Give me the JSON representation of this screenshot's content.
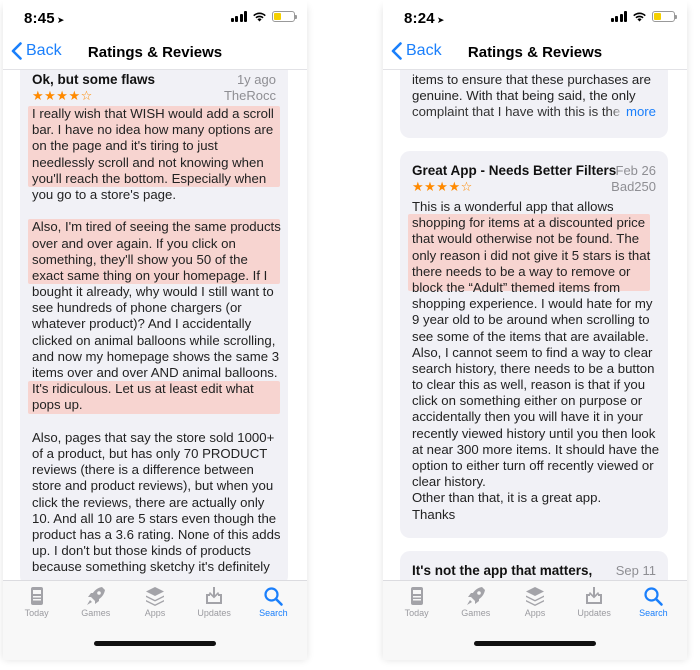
{
  "screens": [
    {
      "status": {
        "time": "8:45",
        "battery_color": "#f5d000"
      },
      "nav": {
        "back_label": "Back",
        "title": "Ratings & Reviews"
      },
      "review": {
        "title": "Ok, but some flaws",
        "date": "1y ago",
        "stars": "★★★★☆",
        "author": "TheRocc",
        "paragraphs": [
          [
            "I really wish that WISH would add a scroll",
            "bar. I have no idea how many options are",
            "on the page and it's tiring to just",
            "needlessly scroll and not knowing when",
            "you'll reach the bottom. Especially when",
            "you go to a store's page."
          ],
          [
            "Also, I'm tired of seeing the same products",
            "over and over again. If you click on",
            "something, they'll show you 50 of the",
            "exact same thing on your homepage. If I",
            "bought it already, why would I still want to",
            "see hundreds of phone chargers (or",
            "whatever product)? And I accidentally",
            "clicked on animal balloons while scrolling,",
            "and now my homepage shows the same 3",
            "items over and over AND animal balloons.",
            "It's ridiculous. Let us at least edit what",
            "pops up."
          ],
          [
            "Also, pages that say the store sold 1000+",
            "of a product, but has only 70 PRODUCT",
            "reviews (there is a difference between",
            "store and product reviews), but when you",
            "click the reviews, there are actually only",
            "10. And all 10 are 5 stars even though the",
            "product has a 3.6 rating. None of this adds",
            "up. I don't but those kinds of products",
            "because something sketchy it's definitely"
          ]
        ]
      },
      "tabs": [
        {
          "label": "Today",
          "icon": "today-icon"
        },
        {
          "label": "Games",
          "icon": "rocket-icon"
        },
        {
          "label": "Apps",
          "icon": "stack-icon"
        },
        {
          "label": "Updates",
          "icon": "download-icon"
        },
        {
          "label": "Search",
          "icon": "search-icon"
        }
      ]
    },
    {
      "status": {
        "time": "8:24",
        "battery_color": "#f5d000"
      },
      "nav": {
        "back_label": "Back",
        "title": "Ratings & Reviews"
      },
      "prev_review": {
        "lines": [
          "items to ensure that these purchases are",
          "genuine. With that being said, the only",
          "complaint that I have with this is the"
        ],
        "more_label": "more"
      },
      "review": {
        "title": "Great App - Needs Better Filters",
        "date": "Feb 26",
        "stars": "★★★★☆",
        "author": "Bad250",
        "lines": [
          "This is a wonderful app that allows",
          "shopping for items at a discounted price",
          "that would otherwise not be found.  The",
          "only reason i did not give it 5 stars is that",
          "there needs to be a way to remove or",
          "block the “Adult” themed items from",
          "shopping experience.  I would hate for my",
          "9 year old to be around when scrolling to",
          "see some of the items that are available.",
          "Also, I cannot seem to find a way to clear",
          "search history, there needs to be a button",
          "to clear this as well, reason is that if you",
          "click on something either on purpose or",
          "accidentally then you will have it in your",
          "recently viewed history until you then look",
          "at near 300 more items.  It should have the",
          "option to either turn off recently viewed or",
          "clear history.",
          "Other than that, it is a great app.",
          "Thanks"
        ]
      },
      "next_review": {
        "title": "It's not the app that matters,",
        "date": "Sep 11"
      },
      "tabs": [
        {
          "label": "Today",
          "icon": "today-icon"
        },
        {
          "label": "Games",
          "icon": "rocket-icon"
        },
        {
          "label": "Apps",
          "icon": "stack-icon"
        },
        {
          "label": "Updates",
          "icon": "download-icon"
        },
        {
          "label": "Search",
          "icon": "search-icon"
        }
      ]
    }
  ],
  "colors": {
    "accent": "#1a7ffb",
    "stars": "#ff8a00",
    "highlight": "#f7d4d0",
    "card": "#f1f1f6"
  }
}
